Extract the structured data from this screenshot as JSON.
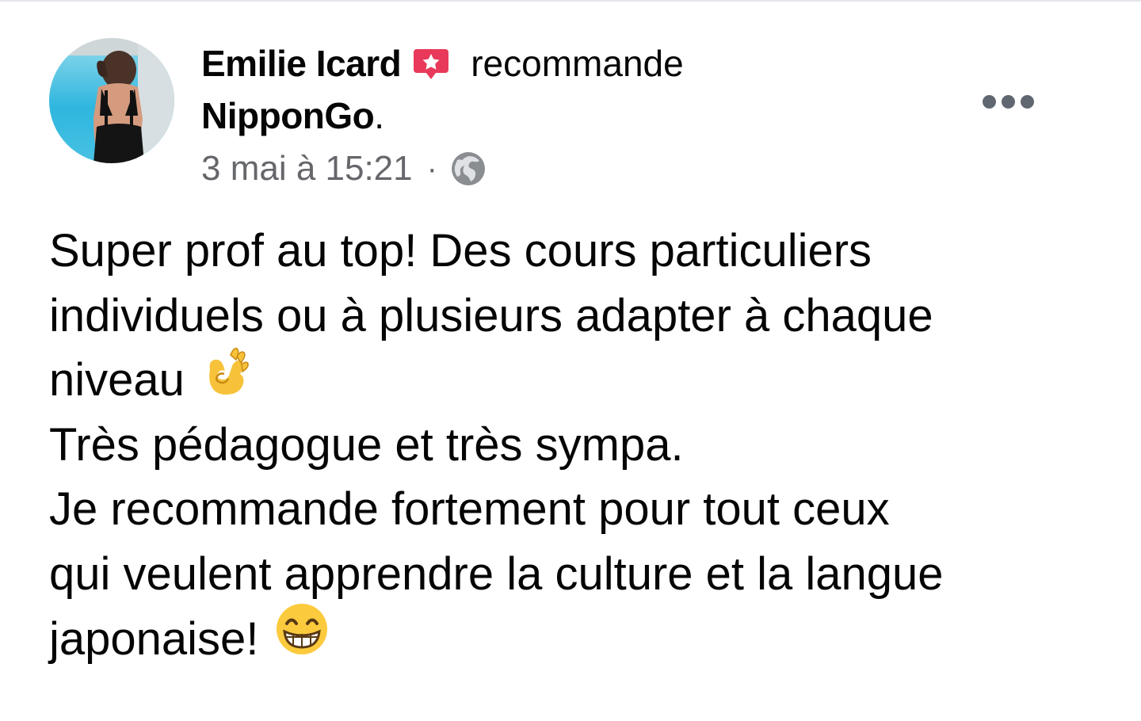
{
  "post": {
    "author": "Emilie Icard",
    "action": "recommande",
    "page": "NipponGo",
    "page_suffix": ".",
    "timestamp": "3 mai à 15:21",
    "separator": "·",
    "privacy_icon": "globe-icon",
    "recommend_icon": "recommendation-badge-icon",
    "more_icon": "more-options-icon",
    "body_lines": [
      "Super prof au top! Des cours particuliers",
      "individuels ou à plusieurs adapter à chaque",
      "niveau",
      "Très pédagogue et très sympa.",
      "Je recommande fortement pour tout ceux",
      "qui veulent apprendre la culture et la langue",
      "japonaise!"
    ],
    "emojis": {
      "line_3": "ok-hand-emoji",
      "line_7": "grinning-face-emoji"
    }
  },
  "colors": {
    "text_primary": "#050505",
    "text_secondary": "#65676b",
    "recommend_badge": "#e8395a",
    "more_dots": "#606770"
  }
}
